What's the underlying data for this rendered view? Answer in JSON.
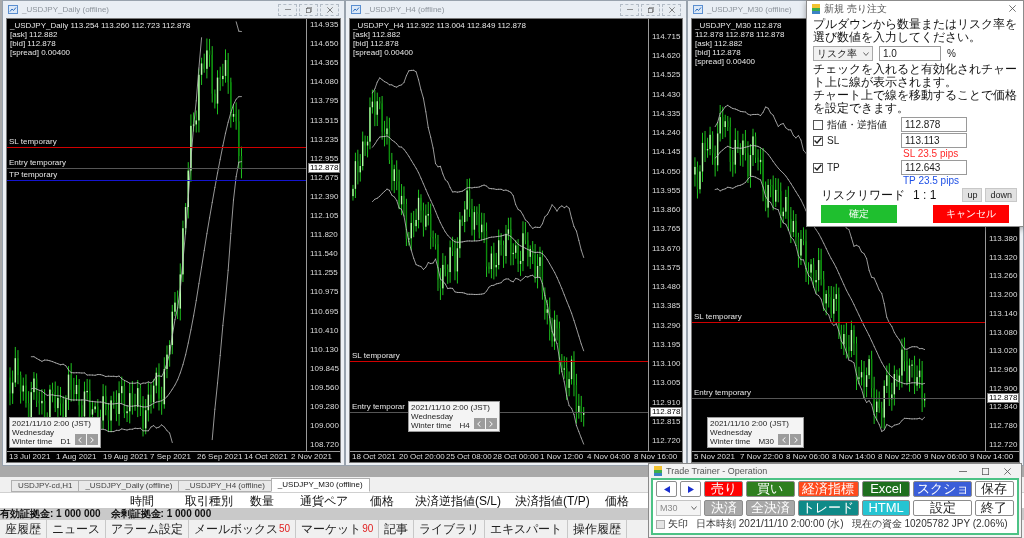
{
  "charts": [
    {
      "title": "_USDJPY_Daily (offline)",
      "window_controls": true,
      "header": "_USDJPY_Daily 113.254 113.260 112.723 112.878",
      "quotes": [
        "[ask] 112.882",
        "[bid] 112.878",
        "[spread] 0.00400"
      ],
      "lines": [
        {
          "kind": "sl",
          "label": "SL temporary"
        },
        {
          "kind": "entry",
          "label": "Entry temporary"
        },
        {
          "kind": "tp",
          "label": "TP temporary"
        }
      ],
      "info": {
        "date": "2021/11/10 2:00 (JST)",
        "weekday": "Wednesday",
        "season": "Winter time",
        "timeframe": "D1"
      },
      "price_labels": [
        "114.935",
        "114.650",
        "114.365",
        "114.080",
        "113.795",
        "113.515",
        "113.235",
        "112.955",
        "112.675",
        "112.390",
        "112.105",
        "111.820",
        "111.540",
        "111.255",
        "110.975",
        "110.695",
        "110.410",
        "110.130",
        "109.845",
        "109.560",
        "109.280",
        "109.000",
        "108.720"
      ],
      "price_tag": "112.878",
      "time_labels": [
        "13 Jul 2021",
        "1 Aug 2021",
        "19 Aug 2021",
        "7 Sep 2021",
        "26 Sep 2021",
        "14 Oct 2021",
        "2 Nov 2021"
      ]
    },
    {
      "title": "_USDJPY_H4 (offline)",
      "window_controls": true,
      "header": "_USDJPY_H4 112.922 113.004 112.849 112.878",
      "quotes": [
        "[ask] 112.882",
        "[bid] 112.878",
        "[spread] 0.00400"
      ],
      "lines": [
        {
          "kind": "sl",
          "label": "SL temporary"
        },
        {
          "kind": "entry",
          "label": "Entry temporar"
        }
      ],
      "info": {
        "date": "2021/11/10 2:00 (JST)",
        "weekday": "Wednesday",
        "season": "Winter time",
        "timeframe": "H4"
      },
      "price_labels": [
        "114.715",
        "114.620",
        "114.525",
        "114.430",
        "114.335",
        "114.240",
        "114.145",
        "114.050",
        "113.955",
        "113.860",
        "113.765",
        "113.670",
        "113.575",
        "113.480",
        "113.385",
        "113.290",
        "113.195",
        "113.100",
        "113.005",
        "112.910",
        "112.815",
        "112.720"
      ],
      "price_tag": "112.878",
      "time_labels": [
        "18 Oct 2021",
        "20 Oct 20:00",
        "25 Oct 08:00",
        "28 Oct 00:00",
        "1 Nov 12:00",
        "4 Nov 04:00",
        "8 Nov 16:00"
      ]
    },
    {
      "title": "_USDJPY_M30 (offline)",
      "header": "_USDJPY_M30 112.878 112.878 112.878 112.878",
      "quotes": [
        "[ask] 112.882",
        "[bid] 112.878",
        "[spread] 0.00400"
      ],
      "lines": [
        {
          "kind": "sl",
          "label": "SL temporary"
        },
        {
          "kind": "entry",
          "label": "Entry temporary"
        }
      ],
      "info": {
        "date": "2021/11/10 2:00 (JST)",
        "weekday": "Wednesday",
        "season": "Winter time",
        "timeframe": "M30"
      },
      "price_labels": [
        "113.380",
        "113.320",
        "113.260",
        "113.200",
        "113.140",
        "113.080",
        "113.020",
        "112.960",
        "112.900",
        "112.840",
        "112.780",
        "112.720"
      ],
      "price_tag": "112.878",
      "time_labels": [
        "5 Nov 2021",
        "7 Nov 22:00",
        "8 Nov 06:00",
        "8 Nov 14:00",
        "8 Nov 22:00",
        "9 Nov 06:00",
        "9 Nov 14:00"
      ]
    }
  ],
  "order_dialog": {
    "title": "新規 売り注文",
    "instruction": "プルダウンから数量またはリスク率を選び数値を入力してください。",
    "mode_select": {
      "value": "リスク率"
    },
    "amount": {
      "value": "1.0",
      "unit": "%"
    },
    "notes": [
      "チェックを入れると有効化されチャート上に線が表示されます。",
      "チャート上で線を移動することで価格を設定できます。"
    ],
    "price_rows": [
      {
        "kind": "limit",
        "label": "指値・逆指値",
        "checked": false,
        "value": "112.878"
      },
      {
        "kind": "sl",
        "label": "SL",
        "checked": true,
        "value": "113.113",
        "pips": "SL 23.5 pips"
      },
      {
        "kind": "tp",
        "label": "TP",
        "checked": true,
        "value": "112.643",
        "pips": "TP 23.5 pips"
      }
    ],
    "risk_reward": {
      "label": "リスクリワード",
      "value": "1 : 1"
    },
    "step_buttons": [
      "up",
      "down"
    ],
    "confirm": "確定",
    "cancel": "キャンセル"
  },
  "chart_tabs": [
    {
      "label": "USDJPY-cd,H1",
      "selected": false
    },
    {
      "label": "_USDJPY_Daily (offline)",
      "selected": false
    },
    {
      "label": "_USDJPY_H4 (offline)",
      "selected": false
    },
    {
      "label": "_USDJPY_M30 (offline)",
      "selected": true
    }
  ],
  "terminal": {
    "columns": [
      "時間",
      "取引種別",
      "数量",
      "通貨ペア",
      "価格",
      "決済逆指値(S/L)",
      "決済指値(T/P)",
      "価格"
    ],
    "summary": [
      "有効証拠金: 1 000 000",
      "余剰証拠金: 1 000 000"
    ],
    "tabs": [
      {
        "label": "座履歴",
        "selected": false
      },
      {
        "label": "ニュース",
        "selected": false
      },
      {
        "label": "アラーム設定",
        "selected": false
      },
      {
        "label": "メールボックス",
        "badge": "50",
        "selected": false
      },
      {
        "label": "マーケット",
        "badge": "90",
        "selected": false
      },
      {
        "label": "記事",
        "selected": false
      },
      {
        "label": "ライブラリ",
        "selected": false
      },
      {
        "label": "エキスパート",
        "selected": false
      },
      {
        "label": "操作履歴",
        "selected": false
      }
    ]
  },
  "trade_trainer": {
    "title": "Trade Trainer - Operation",
    "timeframe": {
      "value": "M30",
      "disabled": true
    },
    "button_rows": [
      [
        {
          "label": "売り",
          "color": "#ff0000"
        },
        {
          "label": "買い",
          "color": "#2f7f1f"
        },
        {
          "label": "経済指標",
          "color": "#ff4a1c"
        },
        {
          "label": "Excel",
          "color": "#1f6f1f"
        },
        {
          "label": "スクショ",
          "color": "#3a5ed8"
        },
        {
          "label": "保存",
          "color": "#ffffff"
        }
      ],
      [
        {
          "label": "決済",
          "color": "#a8a8a8"
        },
        {
          "label": "全決済",
          "color": "#a8a8a8"
        },
        {
          "label": "トレード",
          "color": "#0f8a88"
        },
        {
          "label": "HTML",
          "color": "#25c4d2"
        },
        {
          "label": "設定",
          "color": "#ffffff"
        },
        {
          "label": "終了",
          "color": "#ffffff"
        }
      ]
    ],
    "arrow_checkbox": {
      "label": "矢印",
      "checked": false
    },
    "time": "日本時刻 2021/11/10 2:00:00 (水)",
    "funds": "現在の資金 10205782 JPY (2.06%)"
  }
}
